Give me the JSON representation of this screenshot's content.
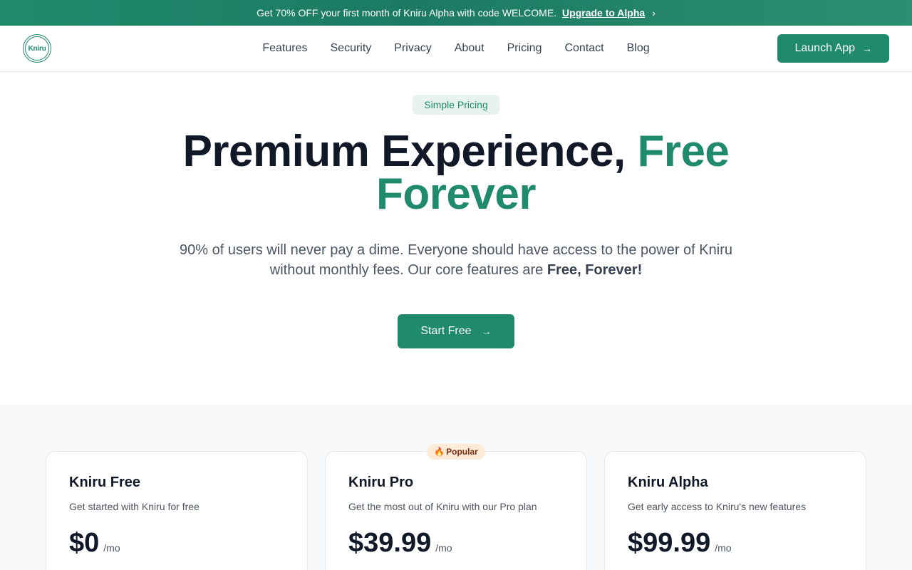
{
  "promo": {
    "text": "Get 70% OFF your first month of Kniru Alpha with code WELCOME.",
    "link": "Upgrade to Alpha",
    "chevron": "›"
  },
  "nav": {
    "logo_text": "Kniru",
    "links": [
      "Features",
      "Security",
      "Privacy",
      "About",
      "Pricing",
      "Contact",
      "Blog"
    ],
    "launch_label": "Launch App",
    "arrow": "→"
  },
  "hero": {
    "badge": "Simple Pricing",
    "headline_main": "Premium Experience, ",
    "headline_accent_1": "Free",
    "headline_accent_2": "Forever",
    "sub_text": "90% of users will never pay a dime. Everyone should have access to the power of Kniru without monthly fees. Our core features are ",
    "sub_bold": "Free, Forever!",
    "cta_label": "Start Free",
    "cta_arrow": "→"
  },
  "plans": [
    {
      "name": "Kniru Free",
      "desc": "Get started with Kniru for free",
      "price": "$0",
      "per": "/mo"
    },
    {
      "name": "Kniru Pro",
      "desc": "Get the most out of Kniru with our Pro plan",
      "price": "$39.99",
      "per": "/mo",
      "badge": "Popular",
      "badge_icon": "🔥"
    },
    {
      "name": "Kniru Alpha",
      "desc": "Get early access to Kniru's new features",
      "price": "$99.99",
      "per": "/mo"
    }
  ],
  "colors": {
    "brand": "#1f8a6c",
    "text": "#111827",
    "muted": "#4b5563"
  }
}
